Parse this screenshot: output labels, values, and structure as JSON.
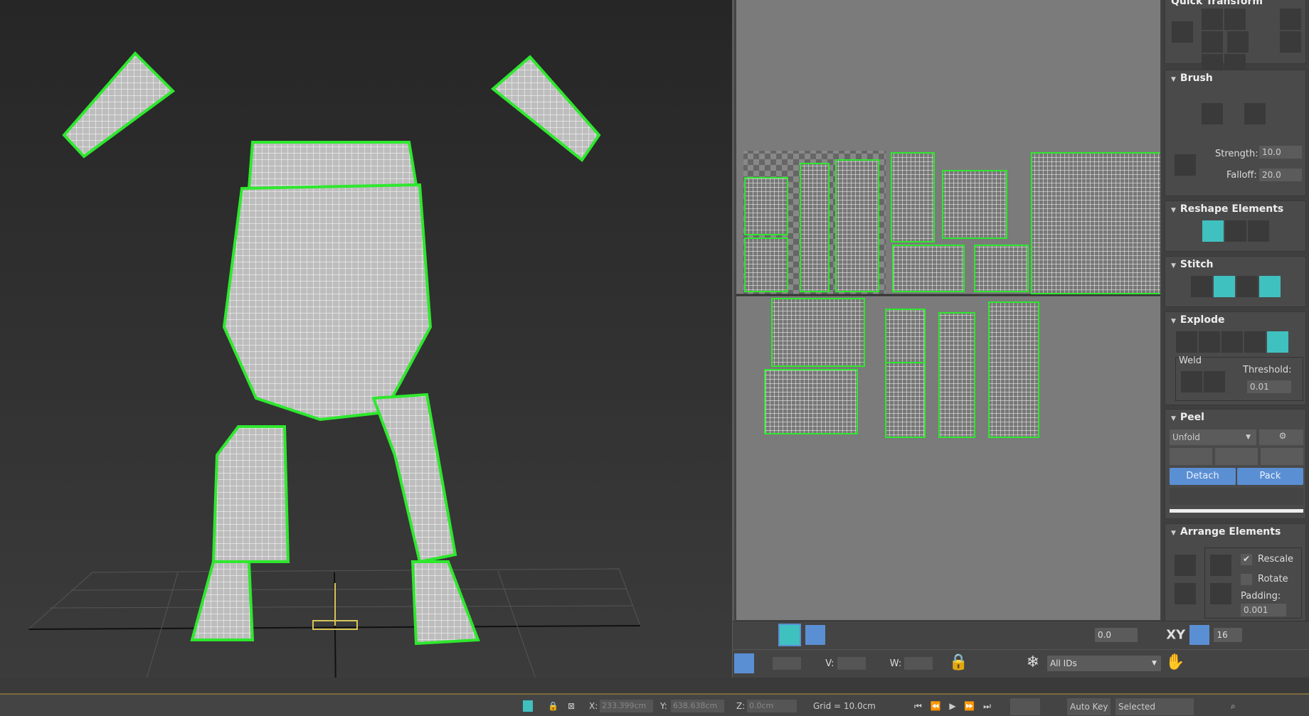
{
  "uv_panel": {
    "quick_transform": {
      "title": "Quick Transform"
    },
    "brush": {
      "title": "Brush",
      "strength_label": "Strength:",
      "strength": "10.0",
      "falloff_label": "Falloff:",
      "falloff": "20.0"
    },
    "reshape": {
      "title": "Reshape Elements"
    },
    "stitch": {
      "title": "Stitch"
    },
    "explode": {
      "title": "Explode",
      "weld_label": "Weld",
      "threshold_label": "Threshold:",
      "threshold": "0.01"
    },
    "peel": {
      "title": "Peel",
      "mode": "Unfold",
      "detach": "Detach",
      "pack": "Pack"
    },
    "arrange": {
      "title": "Arrange Elements",
      "rescale": "Rescale",
      "rescale_checked": true,
      "rotate": "Rotate",
      "rotate_checked": false,
      "padding_label": "Padding:",
      "padding": "0.001"
    }
  },
  "uv_toolbar": {
    "angle": "0.0",
    "xy": "XY",
    "count": "16",
    "v_label": "V:",
    "w_label": "W:",
    "id_filter": "All IDs"
  },
  "status_bar": {
    "x_label": "X:",
    "x": "233.399cm",
    "y_label": "Y:",
    "y": "638.638cm",
    "z_label": "Z:",
    "z": "0.0cm",
    "grid": "Grid = 10.0cm",
    "auto_key": "Auto Key",
    "key_mode": "Selected"
  },
  "colors": {
    "accent": "#3fc1c0",
    "selection": "#2ee82e",
    "button_blue": "#5b8fd3"
  }
}
